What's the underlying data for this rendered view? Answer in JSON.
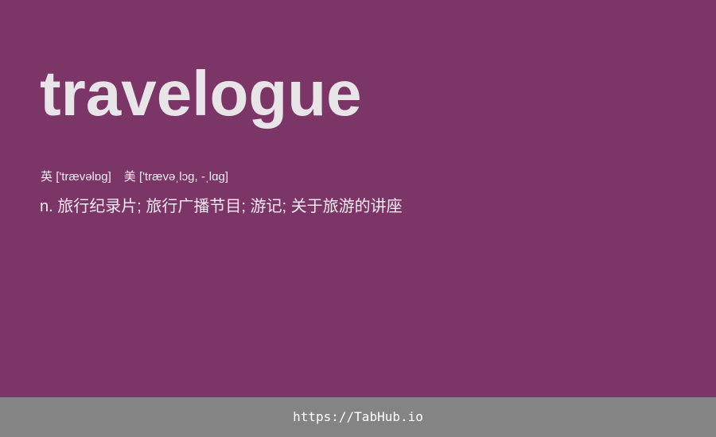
{
  "colors": {
    "background": "#7b3566",
    "footer_background": "#848484",
    "headword_text": "#e8e4e8",
    "body_text": "#f1eaf0"
  },
  "entry": {
    "headword": "travelogue",
    "uk_label": "英",
    "uk_phonetic": "['trævəlɒg]",
    "us_label": "美",
    "us_phonetic": "['trævəˌlɔg, -ˌlɑg]",
    "definition": "n. 旅行纪录片; 旅行广播节目; 游记; 关于旅游的讲座"
  },
  "footer": {
    "link_text": "https://TabHub.io"
  }
}
